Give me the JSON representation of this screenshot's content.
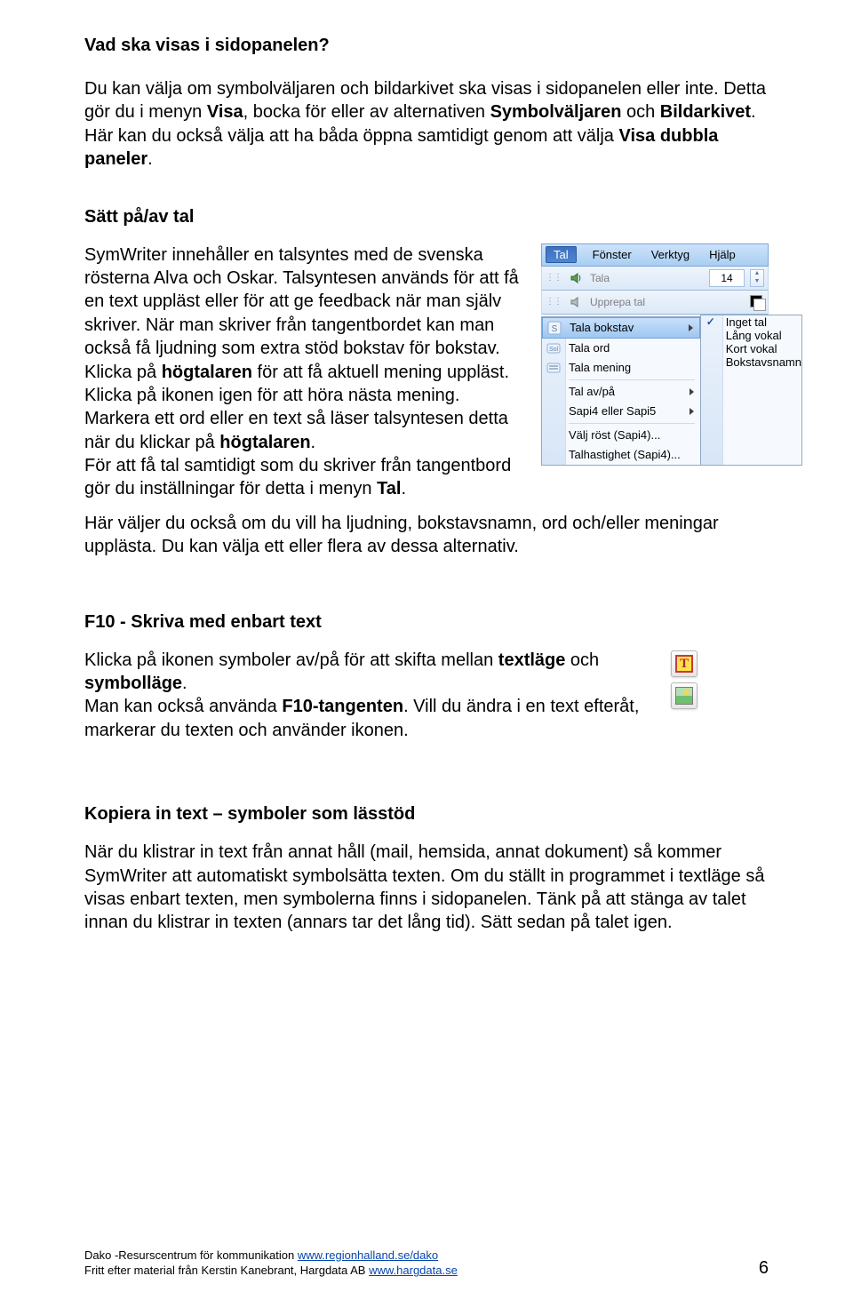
{
  "sections": {
    "s1": {
      "heading": "Vad ska visas i sidopanelen?",
      "p1a": "Du kan välja om symbolväljaren och bildarkivet ska visas i sidopanelen eller inte. Detta gör du i menyn ",
      "p1b": "Visa",
      "p1c": ", bocka för eller av alternativen ",
      "p1d": "Symbolväljaren",
      "p1e": " och ",
      "p1f": "Bildarkivet",
      "p1g": ". Här kan du också välja att ha båda öppna samtidigt genom att välja ",
      "p1h": "Visa dubbla paneler",
      "p1i": "."
    },
    "s2": {
      "heading": "Sätt på/av tal",
      "l1": "SymWriter innehåller en talsyntes med de svenska rösterna Alva och Oskar. Talsyntesen används för att få en text uppläst eller för att ge feedback när man själv skriver. När man skriver från tangentbordet kan man också få ljudning som extra stöd bokstav för bokstav.",
      "l2a": "Klicka på ",
      "l2b": "högtalaren",
      "l2c": " för att få aktuell mening uppläst. Klicka på ikonen igen för att höra nästa mening.",
      "l3a": "Markera ett ord eller en text så läser talsyntesen detta när du klickar på ",
      "l3b": "högtalaren",
      "l3c": ".",
      "l4a": "För att få tal samtidigt som du skriver från tangentbord gör du inställningar för detta i menyn ",
      "l4b": "Tal",
      "l4c": ".",
      "l5": "Här väljer du också om du vill ha ljudning, bokstavsnamn, ord och/eller meningar upplästa. Du kan välja ett eller flera av dessa alternativ."
    },
    "s3": {
      "heading": "F10 - Skriva med enbart text",
      "p1a": "Klicka på ikonen symboler av/på för att skifta mellan ",
      "p1b": "textläge",
      "p1c": " och ",
      "p1d": "symbolläge",
      "p1e": ".",
      "p2a": "Man kan också använda ",
      "p2b": "F10-tangenten",
      "p2c": ". Vill du ändra i en text efteråt, markerar du texten och använder ikonen."
    },
    "s4": {
      "heading": "Kopiera in text – symboler som lässtöd",
      "p": "När du klistrar in text från annat håll (mail, hemsida, annat dokument) så kommer SymWriter att automatiskt symbolsätta texten. Om du ställt in programmet i textläge så visas enbart texten, men symbolerna finns i sidopanelen. Tänk på att stänga av talet innan du klistrar in texten (annars tar det lång tid). Sätt sedan på talet igen."
    }
  },
  "menu": {
    "menubar": {
      "tal": "Tal",
      "fonster": "Fönster",
      "verktyg": "Verktyg",
      "hjalp": "Hjälp"
    },
    "toolbar": {
      "tala": "Tala",
      "upprepa": "Upprepa tal",
      "size": "14"
    },
    "items": {
      "tala_bokstav": "Tala bokstav",
      "tala_ord": "Tala ord",
      "tala_mening": "Tala mening",
      "tal_avpa": "Tal av/på",
      "sapi": "Sapi4 eller Sapi5",
      "valj_rost": "Välj röst (Sapi4)...",
      "talhast": "Talhastighet (Sapi4)..."
    },
    "sub": {
      "inget": "Inget tal",
      "lang": "Lång vokal",
      "kort": "Kort vokal",
      "bokstavsnamn": "Bokstavsnamn"
    }
  },
  "footer": {
    "line1a": "Dako -Resurscentrum för kommunikation ",
    "link1": "www.regionhalland.se/dako",
    "line2a": "Fritt efter material från Kerstin Kanebrant, Hargdata AB  ",
    "link2": "www.hargdata.se",
    "page": "6"
  }
}
